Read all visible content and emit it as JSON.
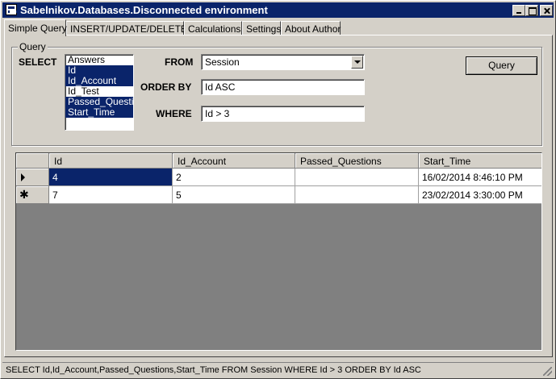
{
  "window": {
    "title": "Sabelnikov.Databases.Disconnected environment"
  },
  "tabs": [
    {
      "label": "Simple Query"
    },
    {
      "label": "INSERT/UPDATE/DELETE"
    },
    {
      "label": "Calculations"
    },
    {
      "label": "Settings"
    },
    {
      "label": "About Author"
    }
  ],
  "query_group": {
    "legend": "Query",
    "select_label": "SELECT",
    "from_label": "FROM",
    "order_by_label": "ORDER BY",
    "where_label": "WHERE",
    "columns": [
      {
        "label": "Answers",
        "selected": false
      },
      {
        "label": "Id",
        "selected": true
      },
      {
        "label": "Id_Account",
        "selected": true
      },
      {
        "label": "Id_Test",
        "selected": false
      },
      {
        "label": "Passed_Questions",
        "selected": true
      },
      {
        "label": "Start_Time",
        "selected": true
      }
    ],
    "from_value": "Session",
    "order_by_value": "Id ASC",
    "where_value": "Id > 3",
    "query_button": "Query"
  },
  "grid": {
    "headers": [
      "Id",
      "Id_Account",
      "Passed_Questions",
      "Start_Time"
    ],
    "rows": [
      [
        "4",
        "2",
        "",
        "16/02/2014 8:46:10 PM"
      ],
      [
        "7",
        "5",
        "",
        "23/02/2014 3:30:00 PM"
      ]
    ],
    "new_row_marker": "✱"
  },
  "status": {
    "text": "SELECT Id,Id_Account,Passed_Questions,Start_Time FROM Session WHERE Id > 3 ORDER BY Id ASC"
  },
  "colors": {
    "titlebar": "#0a246a",
    "selection": "#0a246a",
    "face": "#d4d0c8",
    "grid_background": "#808080"
  }
}
